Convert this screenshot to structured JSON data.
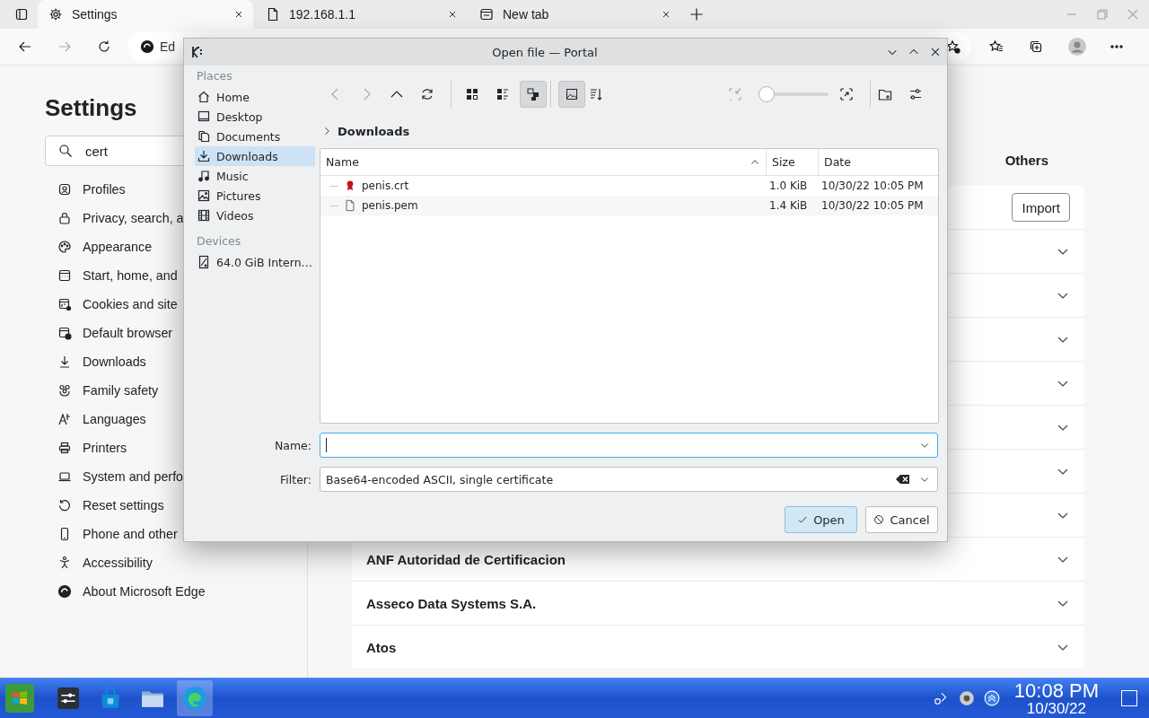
{
  "browser": {
    "tabs": [
      {
        "label": "Settings",
        "selected": true
      },
      {
        "label": "192.168.1.1",
        "selected": false
      },
      {
        "label": "New tab",
        "selected": false
      }
    ],
    "address": {
      "value": "Ed"
    }
  },
  "settings": {
    "title": "Settings",
    "search": {
      "value": "cert"
    },
    "nav": [
      {
        "label": "Profiles"
      },
      {
        "label": "Privacy, search, a"
      },
      {
        "label": "Appearance"
      },
      {
        "label": "Start, home, and"
      },
      {
        "label": "Cookies and site"
      },
      {
        "label": "Default browser"
      },
      {
        "label": "Downloads"
      },
      {
        "label": "Family safety"
      },
      {
        "label": "Languages"
      },
      {
        "label": "Printers"
      },
      {
        "label": "System and perfo"
      },
      {
        "label": "Reset settings"
      },
      {
        "label": "Phone and other"
      },
      {
        "label": "Accessibility"
      },
      {
        "label": "About Microsoft Edge"
      }
    ]
  },
  "certificates": {
    "tab": "Others",
    "import_button": "Import",
    "rows": [
      {
        "expanded": false
      },
      {
        "expanded": false
      },
      {
        "expanded": false
      },
      {
        "expanded": false
      },
      {
        "expanded": false
      },
      {
        "expanded": false
      },
      {
        "expanded": false
      },
      {
        "title": "ANF Autoridad de Certificacion",
        "expanded": false
      },
      {
        "title": "Asseco Data Systems S.A.",
        "expanded": false
      },
      {
        "title": "Atos",
        "expanded": false
      }
    ]
  },
  "dialog": {
    "title": "Open file — Portal",
    "places_header": "Places",
    "places": [
      {
        "label": "Home",
        "selected": false
      },
      {
        "label": "Desktop",
        "selected": false
      },
      {
        "label": "Documents",
        "selected": false
      },
      {
        "label": "Downloads",
        "selected": true
      },
      {
        "label": "Music",
        "selected": false
      },
      {
        "label": "Pictures",
        "selected": false
      },
      {
        "label": "Videos",
        "selected": false
      }
    ],
    "devices_header": "Devices",
    "devices": [
      {
        "label": "64.0 GiB Intern…"
      }
    ],
    "view_modes": [
      {
        "selected": false
      },
      {
        "selected": false
      },
      {
        "selected": true
      }
    ],
    "preview": {
      "selected": true
    },
    "zoom": {
      "level": 0
    },
    "breadcrumb": "Downloads",
    "columns": [
      {
        "label": "Name",
        "sorted": true
      },
      {
        "label": "Size",
        "sorted": false
      },
      {
        "label": "Date",
        "sorted": false
      }
    ],
    "files": [
      {
        "name": "penis.crt",
        "kind": "certificate",
        "size": "1.0 KiB",
        "date": "10/30/22 10:05 PM"
      },
      {
        "name": "penis.pem",
        "kind": "document",
        "size": "1.4 KiB",
        "date": "10/30/22 10:05 PM"
      }
    ],
    "name_field": {
      "label": "Name:",
      "focused": true
    },
    "filter_field": {
      "label": "Filter:",
      "value": "Base64-encoded ASCII, single certificate"
    },
    "buttons": [
      {
        "label": "Open",
        "kind": "default"
      },
      {
        "label": "Cancel",
        "kind": "cancel"
      }
    ]
  },
  "taskbar": {
    "apps": [
      {
        "active": false
      },
      {
        "active": false
      },
      {
        "active": false
      },
      {
        "active": true
      }
    ],
    "time": "10:08 PM",
    "date": "10/30/22"
  }
}
